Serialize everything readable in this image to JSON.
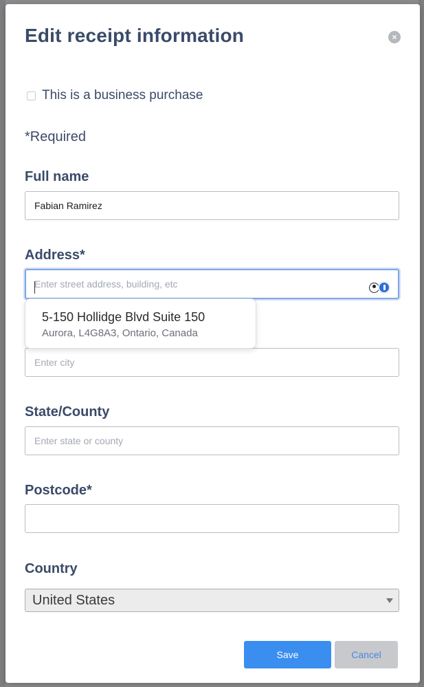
{
  "modal": {
    "title": "Edit receipt information",
    "close_symbol": "×",
    "close_icon": "close-icon"
  },
  "business_purchase": {
    "label": "This is a business purchase",
    "checked": false
  },
  "required_note": "*Required",
  "fields": {
    "full_name": {
      "label": "Full name",
      "value": "Fabian Ramirez",
      "placeholder": ""
    },
    "address": {
      "label": "Address*",
      "value": "",
      "placeholder": "Enter street address, building, etc"
    },
    "city": {
      "value": "",
      "placeholder": "Enter city"
    },
    "state": {
      "label": "State/County",
      "value": "",
      "placeholder": "Enter state or county"
    },
    "postcode": {
      "label": "Postcode*",
      "value": "",
      "placeholder": ""
    },
    "country": {
      "label": "Country",
      "selected": "United States"
    }
  },
  "autocomplete": {
    "line1": "5-150 Hollidge Blvd Suite 150",
    "line2": "Aurora, L4G8A3, Ontario, Canada"
  },
  "autofill_icons": [
    "person-icon",
    "password-manager-icon"
  ],
  "buttons": {
    "save": "Save",
    "cancel": "Cancel"
  },
  "colors": {
    "text": "#3a4a68",
    "primary": "#3a8ef0",
    "focus": "#7fa6e6"
  }
}
